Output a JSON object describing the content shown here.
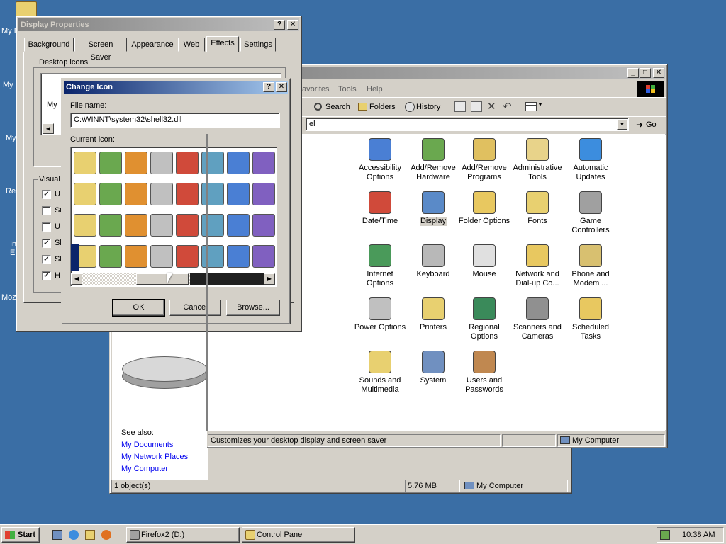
{
  "colors": {
    "desktop": "#3a6ea5",
    "title_active": "#0a246a",
    "title_inactive": "#808080",
    "face": "#d4d0c8",
    "link": "#0000ee"
  },
  "desktop": {
    "labels": [
      "My D",
      "My",
      "My",
      "Re",
      "In E",
      "Moz"
    ]
  },
  "display_properties": {
    "title": "Display Properties",
    "tabs": [
      "Background",
      "Screen Saver",
      "Appearance",
      "Web",
      "Effects",
      "Settings"
    ],
    "active_tab": "Effects",
    "desktop_icons_label": "Desktop icons",
    "desktop_icons_item": "My",
    "visual_label": "Visual",
    "visual_checks": [
      {
        "text": "U",
        "checked": true
      },
      {
        "text": "Sr",
        "checked": false
      },
      {
        "text": "U",
        "checked": false
      },
      {
        "text": "Sl",
        "checked": true
      },
      {
        "text": "Sl",
        "checked": true
      },
      {
        "text": "H",
        "checked": true
      }
    ]
  },
  "change_icon": {
    "title": "Change Icon",
    "file_name_label": "File name:",
    "file_name_value": "C:\\WINNT\\system32\\shell32.dll",
    "current_icon_label": "Current icon:",
    "icons": [
      "folder-open-icon",
      "hourglass-icon",
      "pen-hand-icon",
      "recycle-bin-icon",
      "calendar-window-icon",
      "cd-audio-icon",
      "key-icon",
      "monitor-app-icon",
      "network-computer-icon",
      "settings-gear-icon",
      "back-arrow-icon",
      "shortcut-arrow-icon",
      "folder-settings-icon",
      "removable-disk-icon",
      "tree-icon",
      "search-magnifier-icon",
      "network-tree-icon",
      "search-computer-icon",
      "printer-icon",
      "share-hand-icon",
      "write-notepad-icon",
      "fonts-folder-icon",
      "monitor-folder-icon",
      "globe-display-icon",
      "help-book-icon",
      "file-cube-icon",
      "empty-recycle-icon",
      "control-folder-icon",
      "windows-film-icon",
      "star-folder-icon",
      "lock-icon",
      "search-network-icon"
    ],
    "ok_label": "OK",
    "cancel_label": "Cancel",
    "browse_label": "Browse..."
  },
  "control_panel": {
    "menu": [
      "avorites",
      "Tools",
      "Help"
    ],
    "toolbar": {
      "search": "Search",
      "folders": "Folders",
      "history": "History"
    },
    "address_value": "el",
    "go_label": "Go",
    "left_pane": {
      "display_text": "display",
      "see_also_label": "See also:",
      "links": [
        "My Documents",
        "My Network Places",
        "My Computer"
      ]
    },
    "items": [
      {
        "label": "Accessibility Options",
        "icon": "accessibility-icon",
        "color": "#4a7fd4"
      },
      {
        "label": "Add/Remove Hardware",
        "icon": "hardware-icon",
        "color": "#6aa84f"
      },
      {
        "label": "Add/Remove Programs",
        "icon": "programs-icon",
        "color": "#e0c060"
      },
      {
        "label": "Administrative Tools",
        "icon": "admin-tools-icon",
        "color": "#e8d38a"
      },
      {
        "label": "Automatic Updates",
        "icon": "windows-update-icon",
        "color": "#3c8dde"
      },
      {
        "label": "Date/Time",
        "icon": "clock-icon",
        "color": "#d04a3a"
      },
      {
        "label": "Display",
        "icon": "display-icon",
        "color": "#5a8ac8"
      },
      {
        "label": "Folder Options",
        "icon": "folder-options-icon",
        "color": "#e8c860"
      },
      {
        "label": "Fonts",
        "icon": "fonts-icon",
        "color": "#e8d070"
      },
      {
        "label": "Game Controllers",
        "icon": "joystick-icon",
        "color": "#a0a0a0"
      },
      {
        "label": "Internet Options",
        "icon": "internet-icon",
        "color": "#4a9a5a"
      },
      {
        "label": "Keyboard",
        "icon": "keyboard-icon",
        "color": "#b8b8b8"
      },
      {
        "label": "Mouse",
        "icon": "mouse-icon",
        "color": "#e0e0e0"
      },
      {
        "label": "Network and Dial-up Co...",
        "icon": "network-icon",
        "color": "#e8c860"
      },
      {
        "label": "Phone and Modem ...",
        "icon": "phone-icon",
        "color": "#d8c070"
      },
      {
        "label": "Power Options",
        "icon": "power-icon",
        "color": "#c0c0c0"
      },
      {
        "label": "Printers",
        "icon": "printers-icon",
        "color": "#e8d070"
      },
      {
        "label": "Regional Options",
        "icon": "globe-icon",
        "color": "#3a8a5a"
      },
      {
        "label": "Scanners and Cameras",
        "icon": "scanner-icon",
        "color": "#909090"
      },
      {
        "label": "Scheduled Tasks",
        "icon": "scheduled-tasks-icon",
        "color": "#e8c860"
      },
      {
        "label": "Sounds and Multimedia",
        "icon": "speaker-icon",
        "color": "#e8d070"
      },
      {
        "label": "System",
        "icon": "computer-icon",
        "color": "#7090c0"
      },
      {
        "label": "Users and Passwords",
        "icon": "users-icon",
        "color": "#c08850"
      }
    ],
    "status_text": "Customizes your desktop display and screen saver",
    "status_location": "My Computer"
  },
  "my_computer_window": {
    "status_objects": "1 object(s)",
    "status_size": "5.76 MB",
    "status_location": "My Computer"
  },
  "taskbar": {
    "start_label": "Start",
    "tasks": [
      {
        "label": "Firefox2 (D:)",
        "active": false
      },
      {
        "label": "Control Panel",
        "active": false
      }
    ],
    "clock": "10:38 AM"
  }
}
